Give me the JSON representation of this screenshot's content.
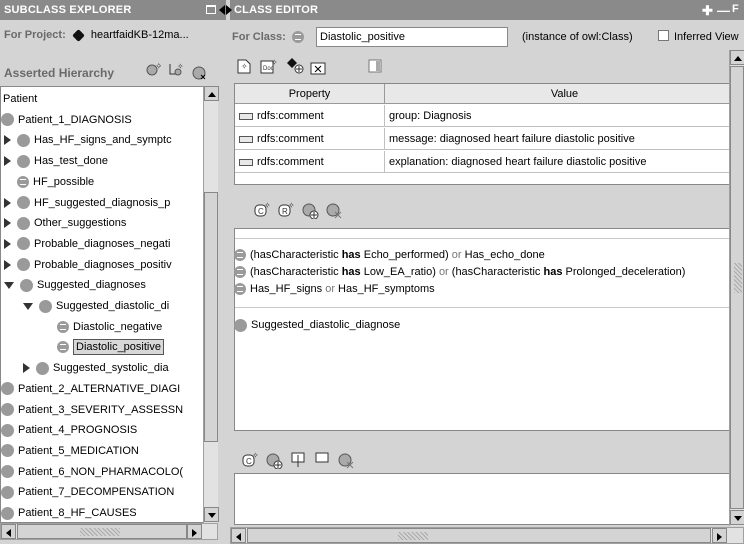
{
  "left": {
    "title": "SUBCLASS EXPLORER",
    "project_label": "For Project:",
    "project_name": "heartfaidKB-12ma...",
    "hierarchy_label": "Asserted Hierarchy",
    "tree": [
      {
        "label": "Patient",
        "depth": 0,
        "icon": "none",
        "expander": "none"
      },
      {
        "label": "Patient_1_DIAGNOSIS",
        "depth": 0,
        "icon": "class",
        "expander": "none"
      },
      {
        "label": "Has_HF_signs_and_symptc",
        "depth": 1,
        "icon": "class",
        "expander": "collapsed"
      },
      {
        "label": "Has_test_done",
        "depth": 1,
        "icon": "class",
        "expander": "collapsed"
      },
      {
        "label": "HF_possible",
        "depth": 1,
        "icon": "defined",
        "expander": "none"
      },
      {
        "label": "HF_suggested_diagnosis_p",
        "depth": 1,
        "icon": "class",
        "expander": "collapsed"
      },
      {
        "label": "Other_suggestions",
        "depth": 1,
        "icon": "class",
        "expander": "collapsed"
      },
      {
        "label": "Probable_diagnoses_negati",
        "depth": 1,
        "icon": "class",
        "expander": "collapsed"
      },
      {
        "label": "Probable_diagnoses_positiv",
        "depth": 1,
        "icon": "class",
        "expander": "collapsed"
      },
      {
        "label": "Suggested_diagnoses",
        "depth": 1,
        "icon": "class",
        "expander": "expanded"
      },
      {
        "label": "Suggested_diastolic_di",
        "depth": 2,
        "icon": "class",
        "expander": "expanded"
      },
      {
        "label": "Diastolic_negative",
        "depth": 3,
        "icon": "defined",
        "expander": "none"
      },
      {
        "label": "Diastolic_positive",
        "depth": 3,
        "icon": "defined",
        "expander": "none",
        "selected": true
      },
      {
        "label": "Suggested_systolic_dia",
        "depth": 2,
        "icon": "class",
        "expander": "collapsed"
      },
      {
        "label": "Patient_2_ALTERNATIVE_DIAGI",
        "depth": 0,
        "icon": "class",
        "expander": "none"
      },
      {
        "label": "Patient_3_SEVERITY_ASSESSN",
        "depth": 0,
        "icon": "class",
        "expander": "none"
      },
      {
        "label": "Patient_4_PROGNOSIS",
        "depth": 0,
        "icon": "class",
        "expander": "none"
      },
      {
        "label": "Patient_5_MEDICATION",
        "depth": 0,
        "icon": "class",
        "expander": "none"
      },
      {
        "label": "Patient_6_NON_PHARMACOLO(",
        "depth": 0,
        "icon": "class",
        "expander": "none"
      },
      {
        "label": "Patient_7_DECOMPENSATION",
        "depth": 0,
        "icon": "class",
        "expander": "none"
      },
      {
        "label": "Patient_8_HF_CAUSES",
        "depth": 0,
        "icon": "class",
        "expander": "none"
      }
    ]
  },
  "right": {
    "title": "CLASS EDITOR",
    "for_class_label": "For Class:",
    "class_name": "Diastolic_positive",
    "instance_of": "(instance of owl:Class)",
    "inferred_view": "Inferred View",
    "columns": [
      "Property",
      "Value"
    ],
    "annotations": [
      {
        "property": "rdfs:comment",
        "value": "group: Diagnosis"
      },
      {
        "property": "rdfs:comment",
        "value": "message: diagnosed heart failure diastolic positive"
      },
      {
        "property": "rdfs:comment",
        "value": "explanation: diagnosed heart failure diastolic positive"
      }
    ],
    "conditions": [
      {
        "parts": [
          "(hasCharacteristic ",
          "has",
          " Echo_performed) ",
          "or",
          " Has_echo_done"
        ]
      },
      {
        "parts": [
          "(hasCharacteristic ",
          "has",
          " Low_EA_ratio) ",
          "or",
          " (hasCharacteristic ",
          "has",
          " Prolonged_deceleration)"
        ]
      },
      {
        "parts": [
          "Has_HF_signs ",
          "or",
          " Has_HF_symptoms",
          "",
          "",
          "",
          ""
        ]
      }
    ],
    "superclass": "Suggested_diastolic_diagnose"
  }
}
